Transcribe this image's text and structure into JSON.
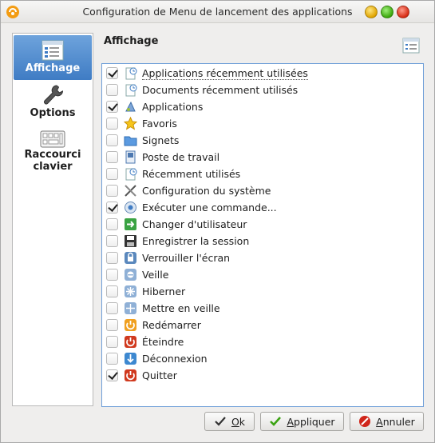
{
  "window": {
    "title": "Configuration de Menu de lancement des applications"
  },
  "sidebar": {
    "items": [
      {
        "label": "Affichage",
        "icon": "display-settings-icon",
        "active": true
      },
      {
        "label": "Options",
        "icon": "wrench-icon",
        "active": false
      },
      {
        "label": "Raccourci clavier",
        "icon": "keyboard-icon",
        "active": false
      }
    ]
  },
  "main": {
    "title": "Affichage",
    "items": [
      {
        "label": "Applications récemment utilisées",
        "checked": true,
        "icon": "recent-applications-icon"
      },
      {
        "label": "Documents récemment utilisés",
        "checked": false,
        "icon": "recent-documents-icon"
      },
      {
        "label": "Applications",
        "checked": true,
        "icon": "applications-icon"
      },
      {
        "label": "Favoris",
        "checked": false,
        "icon": "star-icon"
      },
      {
        "label": "Signets",
        "checked": false,
        "icon": "folder-icon"
      },
      {
        "label": "Poste de travail",
        "checked": false,
        "icon": "computer-icon"
      },
      {
        "label": "Récemment utilisés",
        "checked": false,
        "icon": "recent-icon"
      },
      {
        "label": "Configuration du système",
        "checked": false,
        "icon": "system-settings-icon"
      },
      {
        "label": "Exécuter une commande...",
        "checked": true,
        "icon": "run-command-icon"
      },
      {
        "label": "Changer d'utilisateur",
        "checked": false,
        "icon": "switch-user-icon"
      },
      {
        "label": "Enregistrer la session",
        "checked": false,
        "icon": "save-session-icon"
      },
      {
        "label": "Verrouiller l'écran",
        "checked": false,
        "icon": "lock-screen-icon"
      },
      {
        "label": "Veille",
        "checked": false,
        "icon": "standby-icon"
      },
      {
        "label": "Hiberner",
        "checked": false,
        "icon": "hibernate-icon"
      },
      {
        "label": "Mettre en veille",
        "checked": false,
        "icon": "suspend-icon"
      },
      {
        "label": "Redémarrer",
        "checked": false,
        "icon": "restart-icon"
      },
      {
        "label": "Éteindre",
        "checked": false,
        "icon": "shutdown-icon"
      },
      {
        "label": "Déconnexion",
        "checked": false,
        "icon": "logout-icon"
      },
      {
        "label": "Quitter",
        "checked": true,
        "icon": "quit-icon"
      }
    ]
  },
  "buttons": {
    "ok": {
      "label": "Ok",
      "mnemonic": "O",
      "rest": "k"
    },
    "apply": {
      "label": "Appliquer",
      "mnemonic": "A",
      "rest": "ppliquer"
    },
    "cancel": {
      "label": "Annuler",
      "mnemonic": "A",
      "rest": "nnuler"
    }
  },
  "colors": {
    "accent": "#3f7cc4",
    "list_border": "#6f9fd8"
  }
}
